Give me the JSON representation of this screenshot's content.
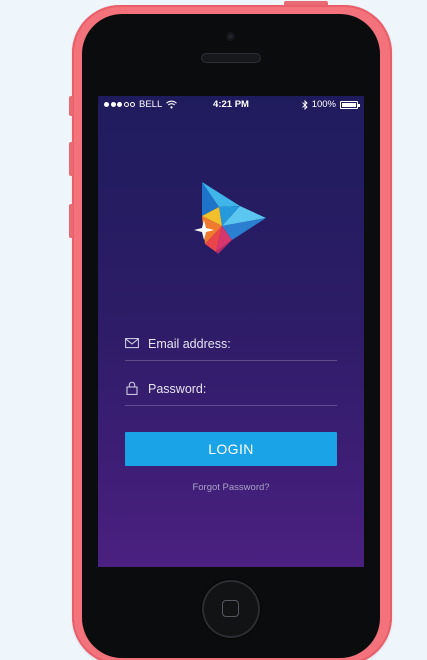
{
  "status_bar": {
    "carrier": "BELL",
    "time": "4:21 PM",
    "battery": "100%",
    "signal_dots_filled": 3,
    "signal_dots_total": 5,
    "icons": [
      "signal-dots-icon",
      "wifi-icon",
      "bluetooth-icon",
      "battery-icon"
    ]
  },
  "login": {
    "email_placeholder": "Email address:",
    "password_placeholder": "Password:",
    "button_label": "LOGIN",
    "forgot_link": "Forgot Password?"
  },
  "colors": {
    "phone_case": "#f3727b",
    "bezel": "#0b0c0e",
    "screen_top": "#1f1c5e",
    "screen_bottom": "#4b2080",
    "login_button": "#1aa3e6",
    "forgot_text": "#a9a2c8"
  }
}
